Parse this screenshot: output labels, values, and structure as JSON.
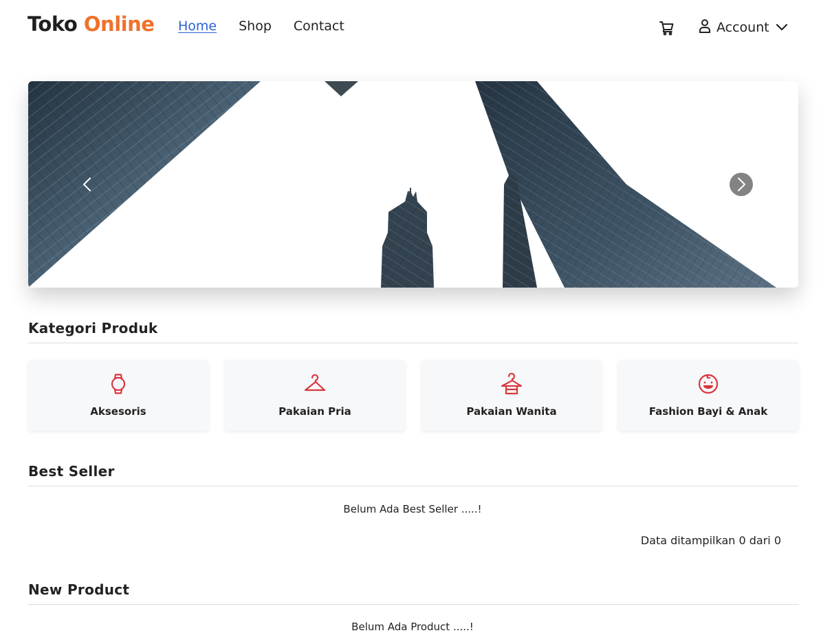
{
  "brand": {
    "part1": "Toko",
    "part2": "Online"
  },
  "nav": {
    "links": [
      {
        "label": "Home"
      },
      {
        "label": "Shop"
      },
      {
        "label": "Contact"
      }
    ],
    "account_label": "Account",
    "cart_icon": "cart-icon",
    "account_icon": "user-icon"
  },
  "carousel": {
    "prev_icon": "chevron-left-icon",
    "next_icon": "chevron-right-icon"
  },
  "categories": {
    "title": "Kategori Produk",
    "items": [
      {
        "label": "Aksesoris",
        "icon": "watch-icon"
      },
      {
        "label": "Pakaian Pria",
        "icon": "hanger-icon"
      },
      {
        "label": "Pakaian Wanita",
        "icon": "dress-hanger-icon"
      },
      {
        "label": "Fashion Bayi & Anak",
        "icon": "baby-face-icon"
      }
    ]
  },
  "best_seller": {
    "title": "Best Seller",
    "empty_message": "Belum Ada Best Seller .....!",
    "data_info": "Data ditampilkan 0 dari 0"
  },
  "new_product": {
    "title": "New Product",
    "empty_message": "Belum Ada Product .....!"
  },
  "colors": {
    "brand_accent": "#f0712c",
    "link_active": "#2a61d6",
    "icon_red": "#d9363e"
  }
}
